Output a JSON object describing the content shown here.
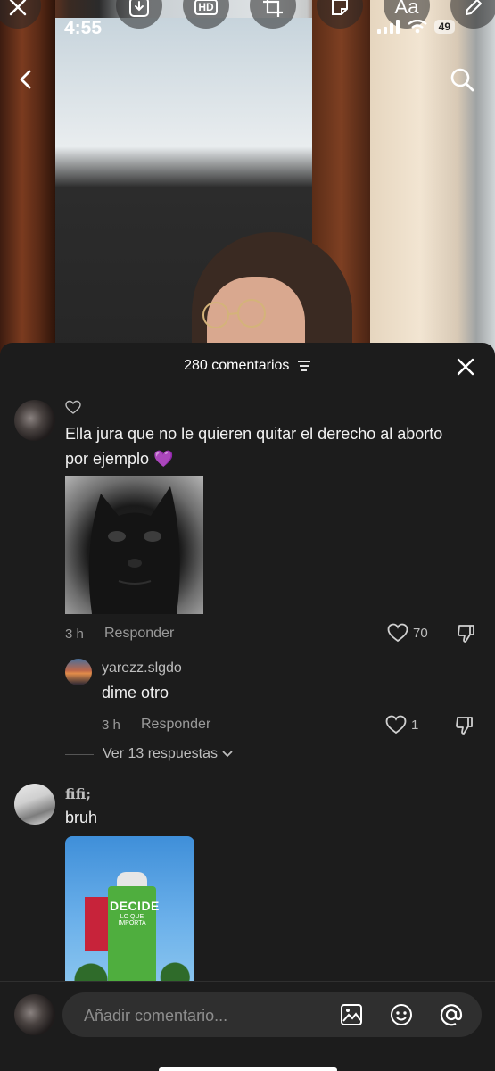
{
  "status_bar": {
    "time": "4:55",
    "battery": "49"
  },
  "toolbar": {
    "hd_label": "HD",
    "text_label": "Aa"
  },
  "comments_sheet": {
    "title": "280 comentarios",
    "comments": [
      {
        "username": "",
        "username_icon": "heart-outline-icon",
        "text": "Ella jura que no le quieren quitar el derecho al aborto por ejemplo 💜",
        "time": "3 h",
        "reply_label": "Responder",
        "likes": "70",
        "image": "black-cat-photo"
      },
      {
        "username": "fifi;",
        "text": "bruh",
        "image": "decide-lo-que-importa-poster"
      }
    ],
    "reply": {
      "username": "yarezz.slgdo",
      "text": "dime otro",
      "time": "3 h",
      "reply_label": "Responder",
      "likes": "1"
    },
    "view_more": "Ver 13 respuestas",
    "poster_text": {
      "title": "DECIDE",
      "subtitle": "LO QUE IMPORTA"
    }
  },
  "input": {
    "placeholder": "Añadir comentario..."
  },
  "colors": {
    "sheet_bg": "#1c1c1c",
    "input_bg": "#2f2f2f",
    "text_secondary": "#9a9a9a",
    "accent_heart": "#a855f7"
  }
}
